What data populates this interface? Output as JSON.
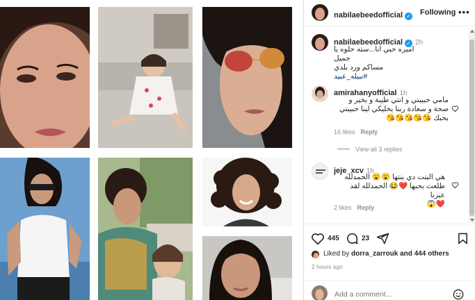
{
  "post": {
    "author": "nabilaebeedofficial",
    "follow_label": "Following",
    "more_label": "•••",
    "caption_time": "2h",
    "caption_line1": "اميره حبي انا...سته حلوه يا جميل",
    "caption_line2": "مساكم ورد بلدي",
    "caption_tag": "#نبيله_عبيد"
  },
  "comments": [
    {
      "user": "amirahanyofficial",
      "time": "1h",
      "line1": "مامي حبيبتي و انتي طيبة و بخير و",
      "line2": "صحة و سعادة ربنا يخليكي لينا حبيبتي",
      "line3": "بحبك 😘😘😘😘😘",
      "likes": "16 likes",
      "reply": "Reply",
      "view_replies": "View all 3 replies"
    },
    {
      "user": "jeje_xcv",
      "time": "1h",
      "line1": "هي البنت دي بنتها 😮😮 الحمدلله",
      "line2": "طلعت بحبها ❤️😂 الحمدلله لقد عبرنا",
      "line3": "❤️😱",
      "likes": "2 likes",
      "reply": "Reply"
    }
  ],
  "actions": {
    "like_count": "445",
    "comment_count": "23",
    "liked_by_prefix": "Liked by",
    "liked_by_user": "dorra_zarrouk",
    "liked_by_suffix": "and 444 others",
    "time_ago": "2 hours ago",
    "add_comment_placeholder": "Add a comment..."
  },
  "colors": {
    "verified": "#1d9bf0",
    "muted": "#8e8e8e",
    "link": "#00376b"
  }
}
